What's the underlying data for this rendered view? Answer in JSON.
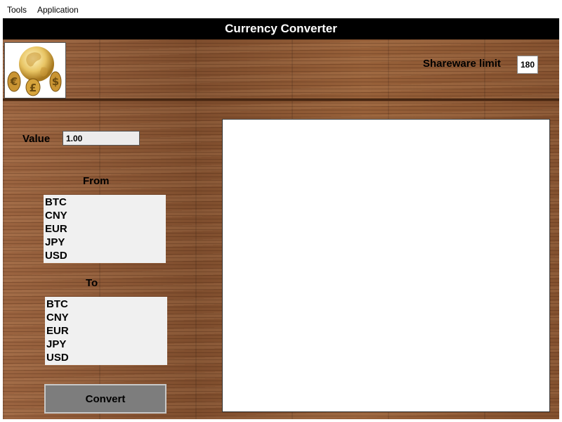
{
  "menubar": {
    "items": [
      "Tools",
      "Application"
    ]
  },
  "window": {
    "title": "Currency Converter"
  },
  "header": {
    "logo_icon": "globe-currency-icon",
    "shareware_label": "Shareware limit",
    "shareware_value": "180"
  },
  "form": {
    "value_label": "Value",
    "value_input": "1.00",
    "from_label": "From",
    "to_label": "To",
    "from_options": [
      "BTC",
      "CNY",
      "EUR",
      "JPY",
      "USD"
    ],
    "to_options": [
      "BTC",
      "CNY",
      "EUR",
      "JPY",
      "USD"
    ],
    "convert_label": "Convert"
  },
  "result": {
    "text": ""
  },
  "colors": {
    "title_bar": "#000000",
    "wood": "#8a5634",
    "button": "#7d7d7d"
  }
}
